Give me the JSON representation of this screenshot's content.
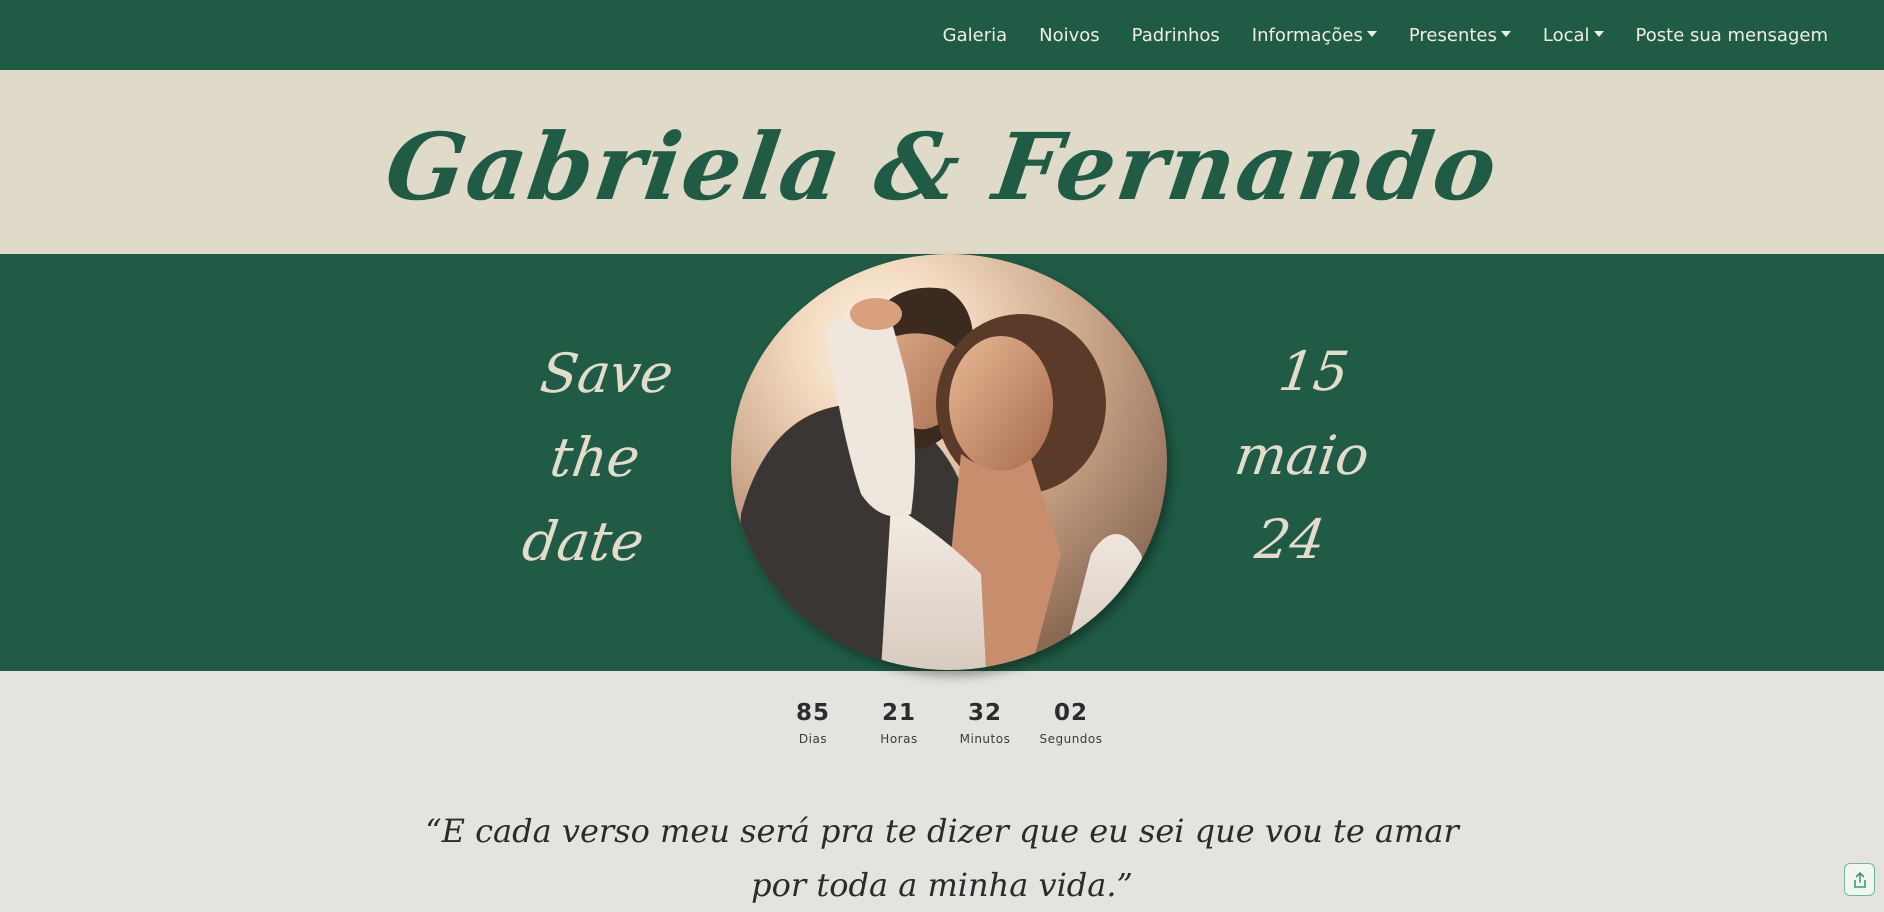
{
  "nav": {
    "items": [
      {
        "label": "Galeria",
        "dropdown": false
      },
      {
        "label": "Noivos",
        "dropdown": false
      },
      {
        "label": "Padrinhos",
        "dropdown": false
      },
      {
        "label": "Informações",
        "dropdown": true
      },
      {
        "label": "Presentes",
        "dropdown": true
      },
      {
        "label": "Local",
        "dropdown": true
      },
      {
        "label": "Poste sua mensagem",
        "dropdown": false
      }
    ]
  },
  "header": {
    "title": "Gabriela & Fernando"
  },
  "hero": {
    "left_lines": [
      "Save",
      "the",
      "date"
    ],
    "right_lines": [
      "15",
      "maio",
      "24"
    ]
  },
  "countdown": {
    "units": [
      {
        "value": "85",
        "label": "Dias"
      },
      {
        "value": "21",
        "label": "Horas"
      },
      {
        "value": "32",
        "label": "Minutos"
      },
      {
        "value": "02",
        "label": "Segundos"
      }
    ]
  },
  "quote": {
    "line1": "“E cada verso meu será pra te dizer que eu sei que vou te amar",
    "line2": "por toda a minha vida.”"
  },
  "colors": {
    "primary_green": "#1f5b45",
    "cream": "#e0dac8",
    "light_bg": "#e4e3df",
    "script_text": "#e3dccb"
  },
  "icons": {
    "share": "share-icon",
    "caret": "chevron-down-icon"
  }
}
